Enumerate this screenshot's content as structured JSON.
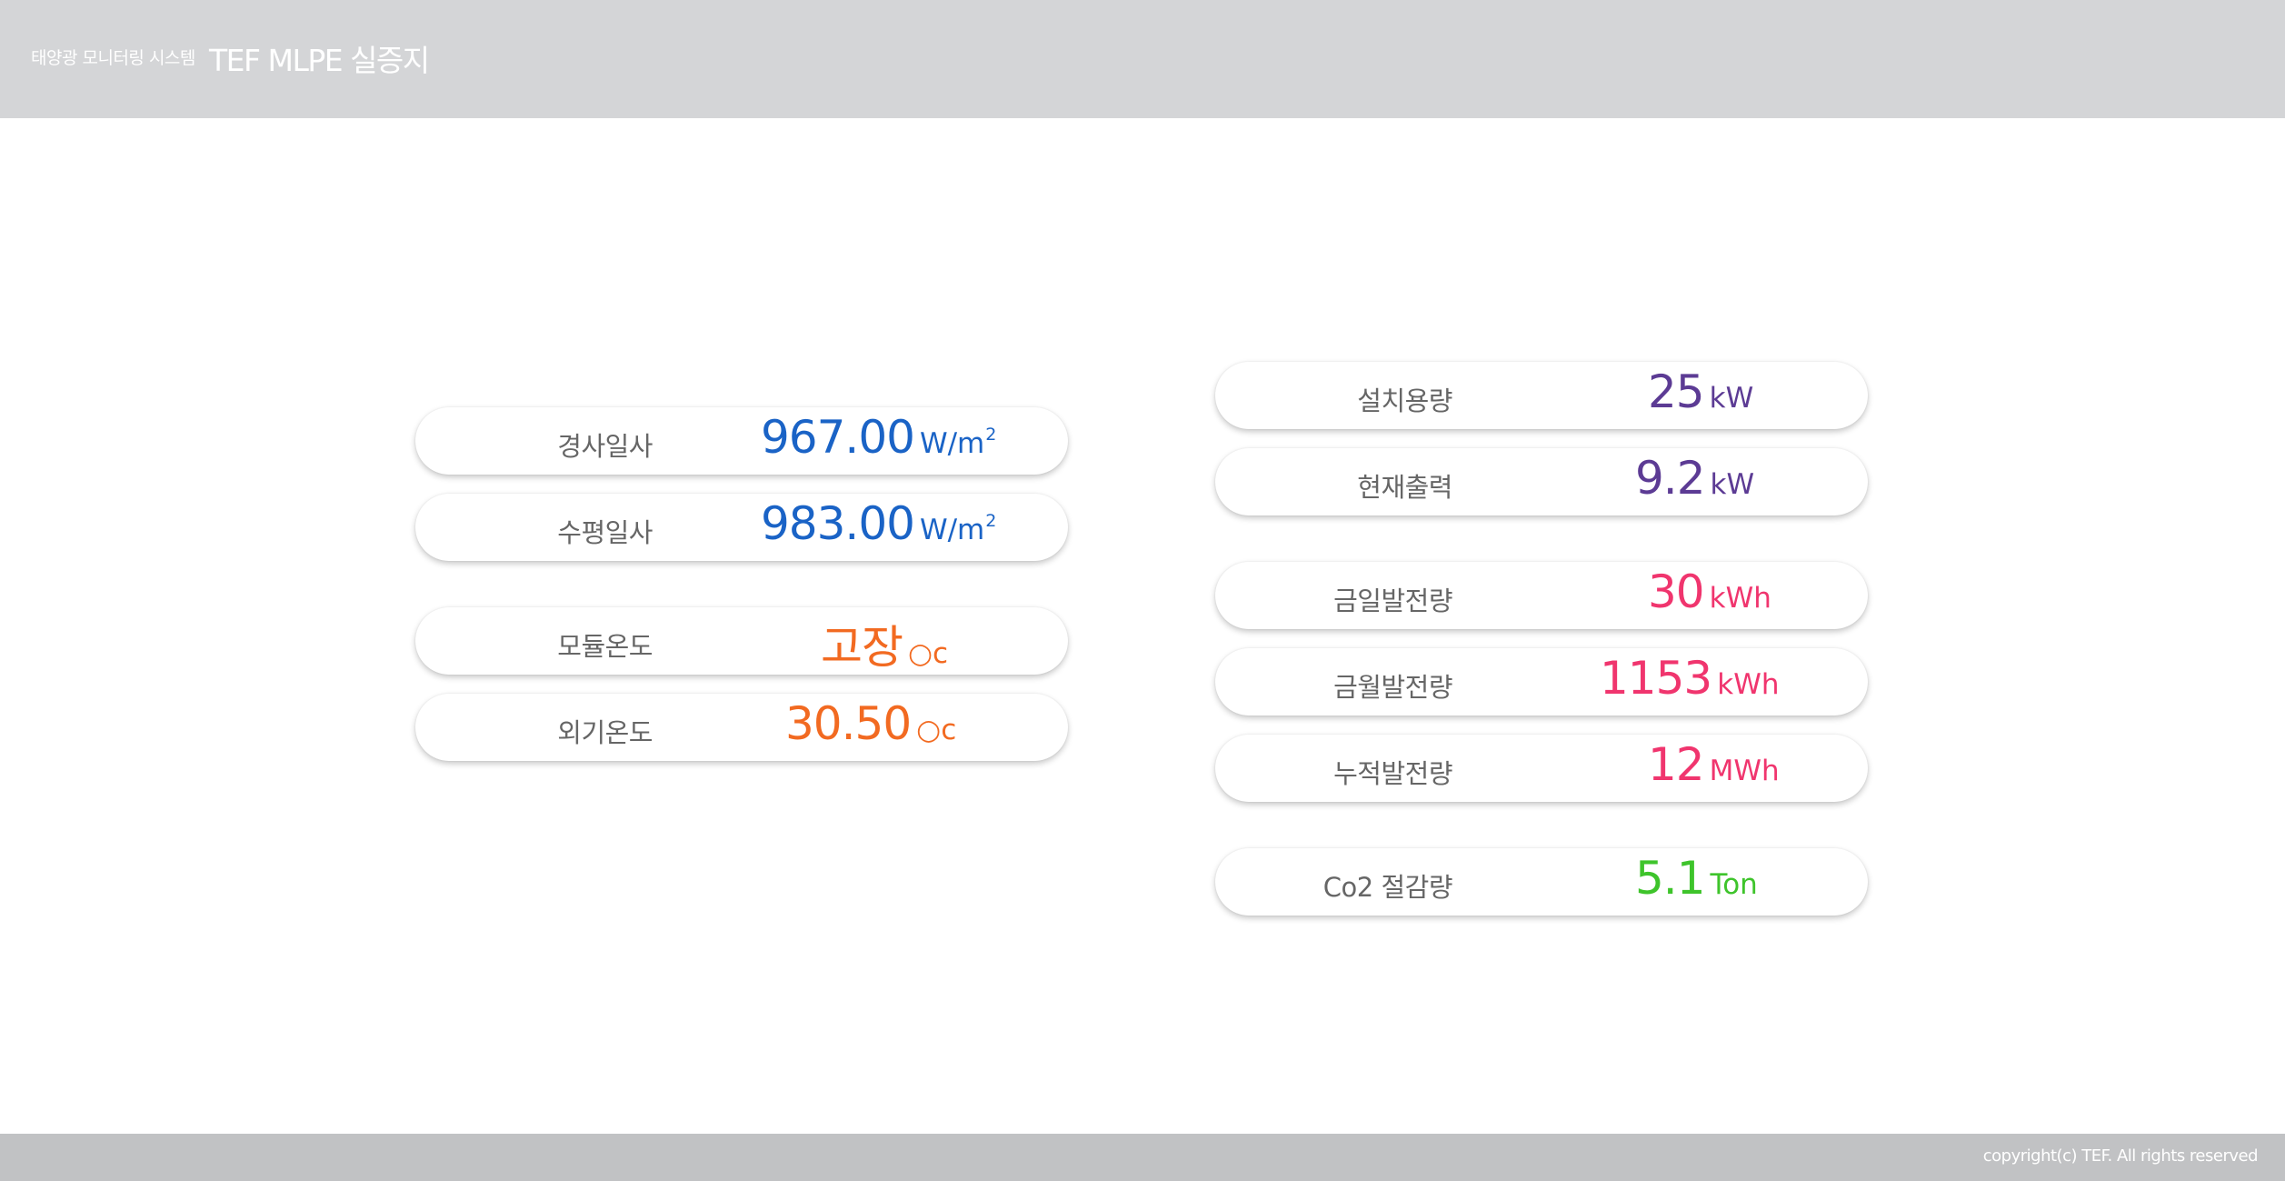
{
  "header": {
    "subtitle": "태양광 모니터링 시스템",
    "title": "TEF MLPE 실증지"
  },
  "colors": {
    "irradiance": "#1a63c6",
    "temperature": "#f26a21",
    "capacity": "#5c3b94",
    "energy": "#f0356e",
    "co2": "#3ec42b",
    "header_bg": "#d4d5d7",
    "footer_bg": "#c1c2c4"
  },
  "left": {
    "irradiance_tilted": {
      "label": "경사일사",
      "value": "967.00",
      "unit": "W/m",
      "unit_sup": "2"
    },
    "irradiance_horizontal": {
      "label": "수평일사",
      "value": "983.00",
      "unit": "W/m",
      "unit_sup": "2"
    },
    "module_temp": {
      "label": "모듈온도",
      "value": "고장",
      "unit": "○c"
    },
    "ambient_temp": {
      "label": "외기온도",
      "value": "30.50",
      "unit": "○c"
    }
  },
  "right": {
    "installed_capacity": {
      "label": "설치용량",
      "value": "25",
      "unit": "kW"
    },
    "current_output": {
      "label": "현재출력",
      "value": "9.2",
      "unit": "kW"
    },
    "daily_generation": {
      "label": "금일발전량",
      "value": "30",
      "unit": "kWh"
    },
    "monthly_generation": {
      "label": "금월발전량",
      "value": "1153",
      "unit": "kWh"
    },
    "total_generation": {
      "label": "누적발전량",
      "value": "12",
      "unit": "MWh"
    },
    "co2_reduction": {
      "label": "Co2 절감량",
      "value": "5.1",
      "unit": "Ton"
    }
  },
  "footer": {
    "copyright": "copyright(c) TEF. All rights reserved"
  }
}
